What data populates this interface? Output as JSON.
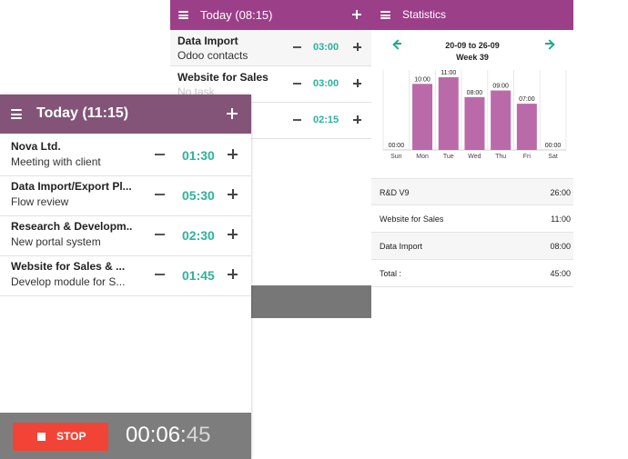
{
  "colors": {
    "header_purple": "#9b3f88",
    "header_muted": "#835478",
    "accent_green": "#2bb39b",
    "bar_fill": "#bb6aa9",
    "stop_red": "#f24436",
    "footer_gray": "#7d7d7d"
  },
  "icons": {
    "menu": "hamburger-icon",
    "add": "plus-icon",
    "decrease": "minus-icon",
    "increase": "plus-icon",
    "prev": "arrow-left-icon",
    "next": "arrow-right-icon",
    "stop": "stop-square-icon"
  },
  "screen_today": {
    "title": "Today (11:15)",
    "items": [
      {
        "title": "Nova Ltd.",
        "subtitle": "Meeting with client",
        "time": "01:30"
      },
      {
        "title": "Data Import/Export Pl...",
        "subtitle": "Flow review",
        "time": "05:30"
      },
      {
        "title": "Research & Developm...",
        "subtitle": "New portal system",
        "time": "02:30"
      },
      {
        "title": "Website for Sales & ...",
        "subtitle": "Develop module for S...",
        "time": "01:45"
      }
    ],
    "footer": {
      "stop_label": "STOP",
      "timer_main": "00:06:",
      "timer_seconds": "45"
    }
  },
  "screen_today_back": {
    "title": "Today (08:15)",
    "items": [
      {
        "title": "Data Import",
        "subtitle": "Odoo contacts",
        "time": "03:00"
      },
      {
        "title": "Website for Sales",
        "subtitle": "No task",
        "time": "03:00"
      },
      {
        "title": "",
        "subtitle": "",
        "time": "02:15"
      }
    ]
  },
  "screen_statistics": {
    "title": "Statistics",
    "range": "20-09 to 26-09",
    "week": "Week 39",
    "summary": [
      {
        "label": "R&D V9",
        "value": "26:00"
      },
      {
        "label": "Website for Sales",
        "value": "11:00"
      },
      {
        "label": "Data Import",
        "value": "08:00"
      },
      {
        "label": "Total :",
        "value": "45:00"
      }
    ]
  },
  "chart_data": {
    "type": "bar",
    "categories": [
      "Sun",
      "Mon",
      "Tue",
      "Wed",
      "Thu",
      "Fri",
      "Sat"
    ],
    "values": [
      0,
      10,
      11,
      8,
      9,
      7,
      0
    ],
    "data_labels": [
      "00:00",
      "10:00",
      "11:00",
      "08:00",
      "09:00",
      "07:00",
      "00:00"
    ],
    "ylim": [
      0,
      11
    ],
    "grid": false,
    "legend": "none",
    "title": "",
    "xlabel": "",
    "ylabel": ""
  }
}
